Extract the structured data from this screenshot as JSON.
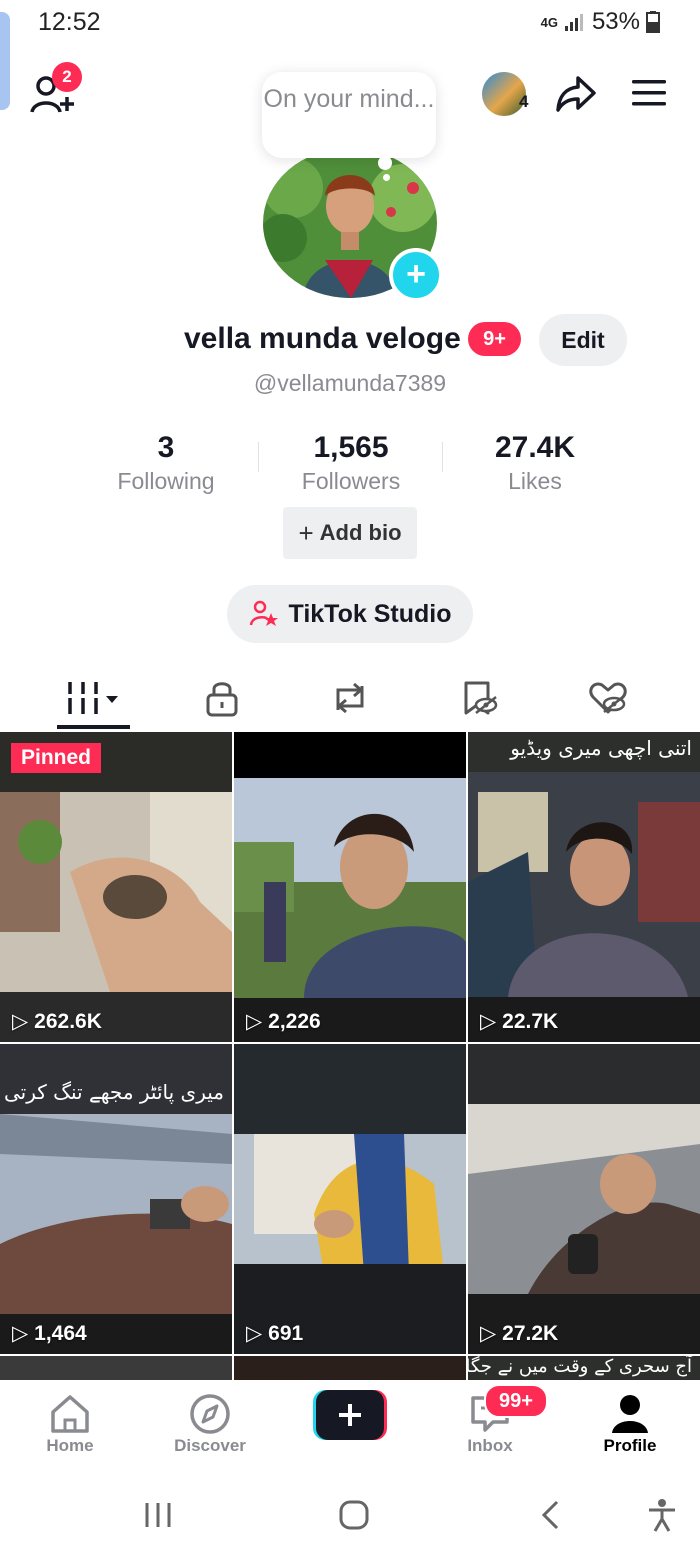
{
  "status_bar": {
    "time": "12:52",
    "network": "4G",
    "battery": "53%"
  },
  "header": {
    "add_friend_badge": "2",
    "avatar_count": "4"
  },
  "bubble": {
    "text": "On your mind..."
  },
  "profile": {
    "username": "vella munda veloge",
    "username_badge": "9+",
    "edit_label": "Edit",
    "handle": "@vellamunda7389"
  },
  "stats": [
    {
      "value": "3",
      "label": "Following"
    },
    {
      "value": "1,565",
      "label": "Followers"
    },
    {
      "value": "27.4K",
      "label": "Likes"
    }
  ],
  "add_bio_label": "Add bio",
  "studio_label": "TikTok Studio",
  "tabs": [
    "videos-grid-icon",
    "lock-icon",
    "repost-icon",
    "favorites-icon",
    "liked-icon"
  ],
  "videos": [
    {
      "views": "262.6K",
      "pinned": "Pinned",
      "caption": ""
    },
    {
      "views": "2,226",
      "caption": ""
    },
    {
      "views": "22.7K",
      "caption": "اتنی اچھی میری ویڈیو"
    },
    {
      "views": "1,464",
      "caption": "میری پائٹر مجھے تنگ کرتی ہے"
    },
    {
      "views": "691",
      "caption": ""
    },
    {
      "views": "27.2K",
      "caption": ""
    }
  ],
  "next_row_caption": "آج سحری کے وقت میں نے جگایا",
  "bottom_nav": {
    "home": "Home",
    "discover": "Discover",
    "inbox": "Inbox",
    "inbox_badge": "99+",
    "profile": "Profile"
  },
  "colors": {
    "accent": "#fe2c55",
    "cyan": "#20d5ec",
    "text": "#161823",
    "muted": "#8a8b91"
  }
}
